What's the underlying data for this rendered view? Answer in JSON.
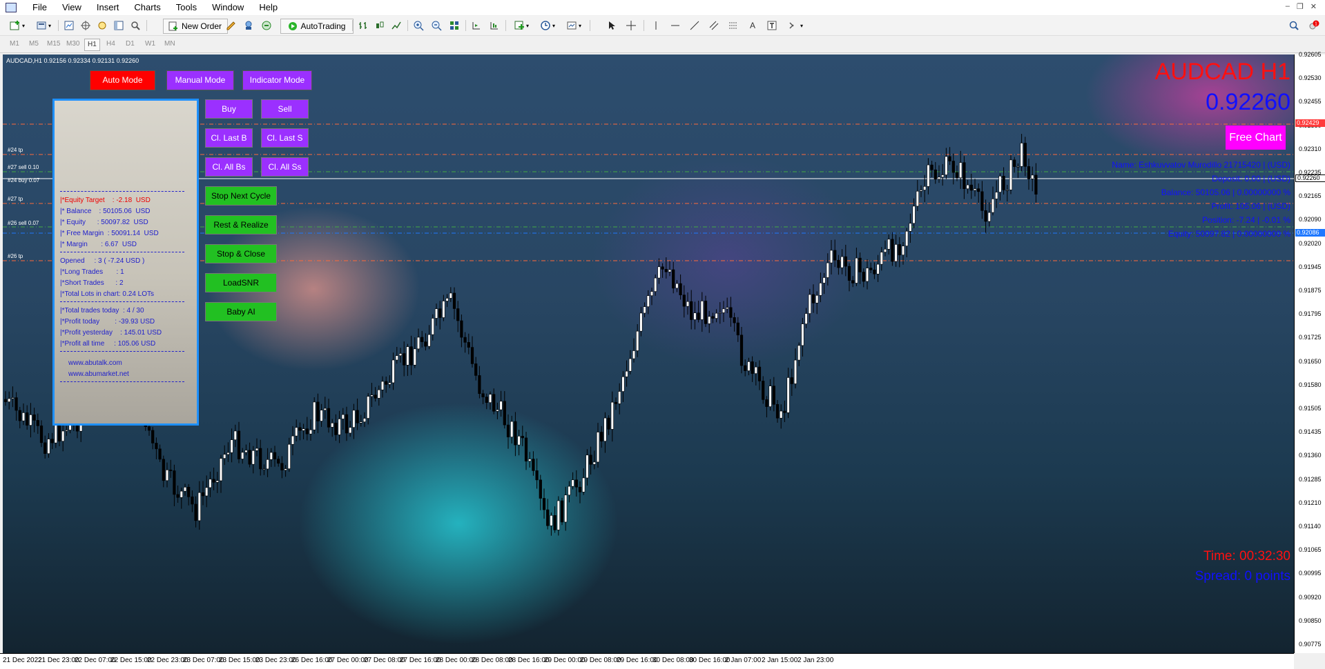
{
  "menu": [
    "File",
    "View",
    "Insert",
    "Charts",
    "Tools",
    "Window",
    "Help"
  ],
  "toolbar": {
    "new_order": "New Order",
    "autotrading": "AutoTrading"
  },
  "timeframes": [
    "M1",
    "M5",
    "M15",
    "M30",
    "H1",
    "H4",
    "D1",
    "W1",
    "MN"
  ],
  "active_timeframe": "H1",
  "chart": {
    "info": "AUDCAD,H1  0.92156 0.92334 0.92131 0.92260",
    "symbol_title": "AUDCAD H1",
    "price_big": "0.92260",
    "free_chart": "Free Chart",
    "timer": "Time: 00:32:30",
    "spread": "Spread: 0 points"
  },
  "modes": {
    "auto": "Auto Mode",
    "manual": "Manual Mode",
    "indicator": "Indicator Mode"
  },
  "buttons": {
    "buy": "Buy",
    "sell": "Sell",
    "cl_last_b": "Cl. Last B",
    "cl_last_s": "Cl. Last S",
    "cl_all_bs": "Cl. All Bs",
    "cl_all_ss": "Cl. All Ss",
    "stop_next_cycle": "Stop Next Cycle",
    "rest_realize": "Rest & Realize",
    "stop_close": "Stop & Close",
    "load_snr": "LoadSNR",
    "baby_ai": "Baby AI"
  },
  "panel": {
    "equity_target": "|*Equity Target    : -2.18  USD",
    "balance": "|* Balance    : 50105.06  USD",
    "equity": "|* Equity      : 50097.82  USD",
    "free_margin": "|* Free Margin  : 50091.14  USD",
    "margin": "|* Margin       : 6.67  USD",
    "opened": "Opened     : 3 ( -7.24 USD )",
    "long_trades": "|*Long Trades       : 1",
    "short_trades": "|*Short Trades      : 2",
    "total_lots": "|*Total Lots in chart: 0.24 LOTs",
    "trades_today": "|*Total trades today  : 4 / 30",
    "profit_today": "|*Profit today        : -39.93 USD",
    "profit_yesterday": "|*Profit yesterday    : 145.01 USD",
    "profit_all": "|*Profit all time     : 105.06 USD",
    "site1": "www.abutalk.com",
    "site2": "www.abumarket.net"
  },
  "account": {
    "name": "Name: Eshkuvvatov Murodillo 21715420 | (USD)",
    "deposit": "Deposit: 0.00 | (USD)",
    "balance": "Balance: 50105.06 | 0.00000000 %",
    "profit": "Profit: 105.06 | (USD)",
    "position": "Position: -7.24 | -0.01 %",
    "equity": "Equity: 50097.82 | 0.00000000 %"
  },
  "levels": [
    "#24 tp",
    "#27 sell 0.10",
    "#24 buy 0.07",
    "#27 tp",
    "#26 sell 0.07",
    "#26 tp"
  ],
  "price_scale": [
    "0.92605",
    "0.92530",
    "0.92455",
    "0.92380",
    "0.92310",
    "0.92235",
    "0.92165",
    "0.92090",
    "0.92020",
    "0.91945",
    "0.91875",
    "0.91795",
    "0.91725",
    "0.91650",
    "0.91580",
    "0.91505",
    "0.91435",
    "0.91360",
    "0.91285",
    "0.91210",
    "0.91140",
    "0.91065",
    "0.90995",
    "0.90920",
    "0.90850",
    "0.90775"
  ],
  "price_tags": {
    "red": {
      "text": "0.92429",
      "color": "#ff3b3b"
    },
    "current": {
      "text": "0.92260",
      "color": "#ffffff"
    },
    "blue": {
      "text": "0.92086",
      "color": "#1e78ff"
    }
  },
  "time_scale": [
    "21 Dec 2022",
    "21 Dec 23:00",
    "22 Dec 07:00",
    "22 Dec 15:00",
    "22 Dec 23:00",
    "23 Dec 07:00",
    "23 Dec 15:00",
    "23 Dec 23:00",
    "26 Dec 16:00",
    "27 Dec 00:00",
    "27 Dec 08:00",
    "27 Dec 16:00",
    "28 Dec 00:00",
    "28 Dec 08:00",
    "28 Dec 16:00",
    "29 Dec 00:00",
    "29 Dec 08:00",
    "29 Dec 16:00",
    "30 Dec 08:00",
    "30 Dec 16:00",
    "2 Jan 07:00",
    "2 Jan 15:00",
    "2 Jan 23:00"
  ],
  "colors": {
    "mode_auto": "#ff0000",
    "mode_other": "#9b30ff",
    "action": "#9b30ff",
    "green": "#22c022",
    "panel_border": "#1e90ff"
  }
}
